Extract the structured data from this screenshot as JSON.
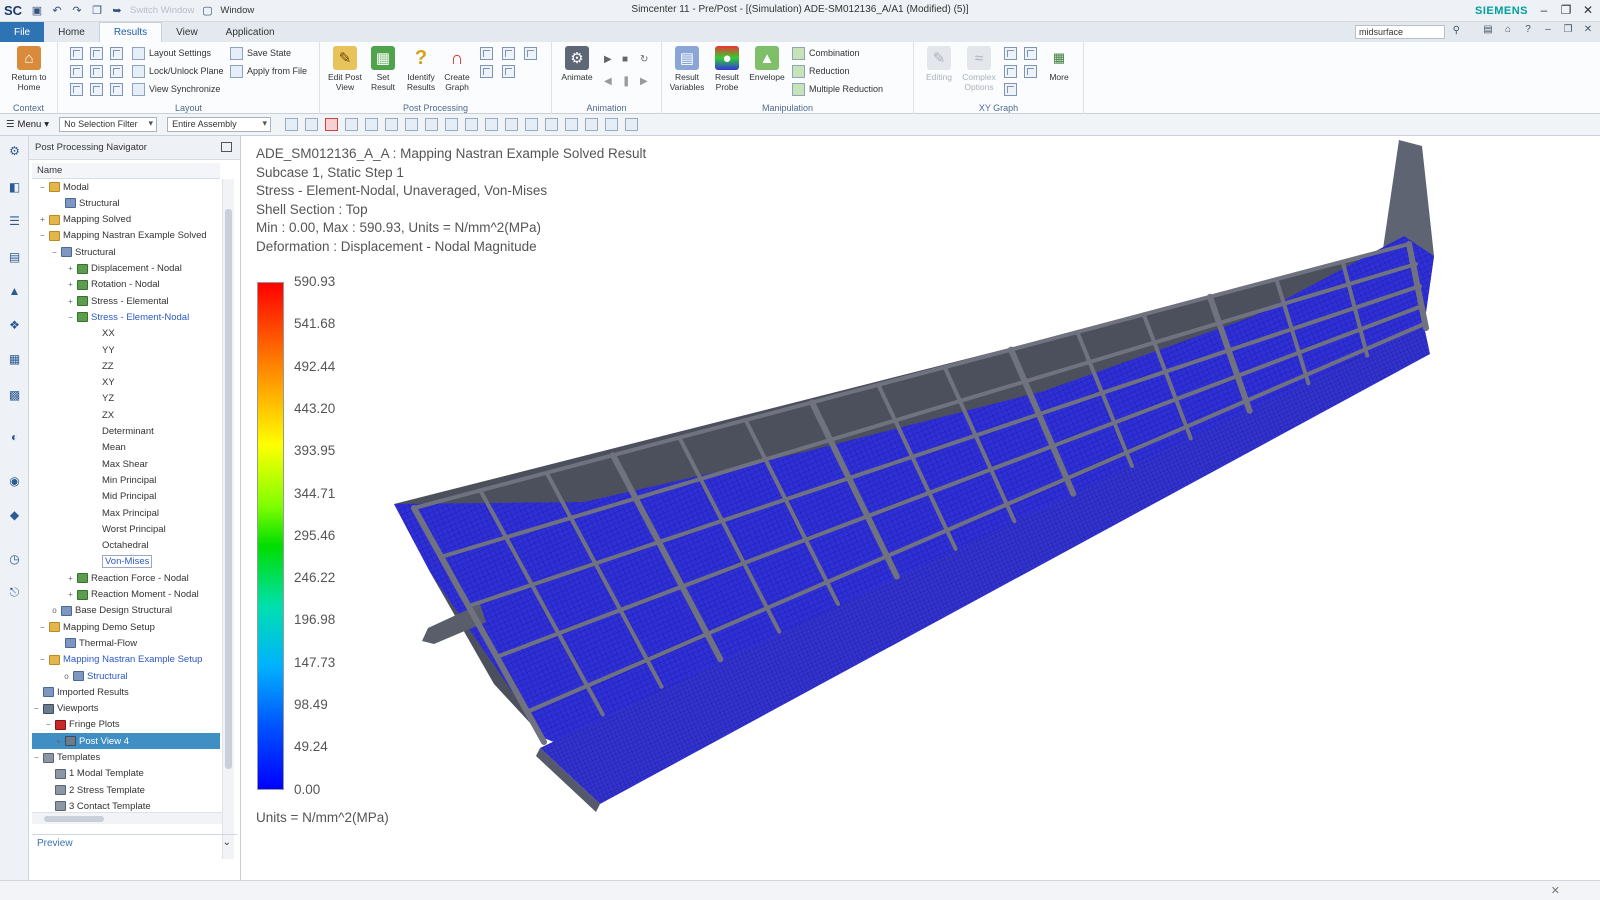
{
  "titlebar": {
    "logo": "SC",
    "switch_window": "Switch Window",
    "window_menu": "Window",
    "title": "Simcenter 11 - Pre/Post - [(Simulation) ADE-SM012136_A/A1 (Modified)   (5)]",
    "brand": "SIEMENS"
  },
  "tabs": [
    {
      "label": "File",
      "kind": "file"
    },
    {
      "label": "Home",
      "kind": "normal"
    },
    {
      "label": "Results",
      "kind": "active"
    },
    {
      "label": "View",
      "kind": "normal"
    },
    {
      "label": "Application",
      "kind": "normal"
    }
  ],
  "search": {
    "value": "midsurface"
  },
  "ribbon": {
    "context": {
      "label": "Context",
      "return_home": "Return to Home"
    },
    "layout": {
      "label": "Layout",
      "layout_settings": "Layout Settings",
      "lock_unlock": "Lock/Unlock Plane",
      "view_sync": "View Synchronize",
      "save_state": "Save State",
      "apply_from_file": "Apply from File"
    },
    "post_processing": {
      "label": "Post Processing",
      "edit_post_view": "Edit Post View",
      "set_result": "Set Result",
      "identify_results": "Identify Results",
      "create_graph": "Create Graph"
    },
    "animation": {
      "label": "Animation",
      "animate": "Animate"
    },
    "manipulation": {
      "label": "Manipulation",
      "result_variables": "Result Variables",
      "result_probe": "Result Probe",
      "envelope": "Envelope",
      "combination": "Combination",
      "reduction": "Reduction",
      "multiple_reduction": "Multiple Reduction"
    },
    "xy_graph": {
      "label": "XY Graph",
      "editing": "Editing",
      "complex_options": "Complex Options",
      "more": "More"
    }
  },
  "toolbar": {
    "menu": "Menu",
    "selection_filter": "No Selection Filter",
    "scope": "Entire Assembly"
  },
  "navigator": {
    "title": "Post Processing Navigator",
    "column": "Name",
    "rows": [
      {
        "label": "Modal",
        "icon": "folder",
        "exp": "−"
      },
      {
        "label": "Structural",
        "icon": "struct",
        "exp": ""
      },
      {
        "label": "Mapping Solved",
        "icon": "folder",
        "exp": "+"
      },
      {
        "label": "Mapping Nastran Example Solved",
        "icon": "folder",
        "exp": "−"
      },
      {
        "label": "Structural",
        "icon": "struct",
        "exp": "−"
      },
      {
        "label": "Displacement - Nodal",
        "icon": "res",
        "exp": "+"
      },
      {
        "label": "Rotation - Nodal",
        "icon": "res",
        "exp": "+"
      },
      {
        "label": "Stress - Elemental",
        "icon": "res",
        "exp": "+"
      },
      {
        "label": "Stress - Element-Nodal",
        "icon": "res",
        "exp": "−",
        "style": "link"
      },
      {
        "label": "XX",
        "icon": "none",
        "exp": ""
      },
      {
        "label": "YY",
        "icon": "none",
        "exp": ""
      },
      {
        "label": "ZZ",
        "icon": "none",
        "exp": ""
      },
      {
        "label": "XY",
        "icon": "none",
        "exp": ""
      },
      {
        "label": "YZ",
        "icon": "none",
        "exp": ""
      },
      {
        "label": "ZX",
        "icon": "none",
        "exp": ""
      },
      {
        "label": "Determinant",
        "icon": "none",
        "exp": ""
      },
      {
        "label": "Mean",
        "icon": "none",
        "exp": ""
      },
      {
        "label": "Max Shear",
        "icon": "none",
        "exp": ""
      },
      {
        "label": "Min Principal",
        "icon": "none",
        "exp": ""
      },
      {
        "label": "Mid Principal",
        "icon": "none",
        "exp": ""
      },
      {
        "label": "Max Principal",
        "icon": "none",
        "exp": ""
      },
      {
        "label": "Worst Principal",
        "icon": "none",
        "exp": ""
      },
      {
        "label": "Octahedral",
        "icon": "none",
        "exp": ""
      },
      {
        "label": "Von-Mises",
        "icon": "none",
        "exp": "",
        "style": "boxed"
      },
      {
        "label": "Reaction Force - Nodal",
        "icon": "res",
        "exp": "+"
      },
      {
        "label": "Reaction Moment - Nodal",
        "icon": "res",
        "exp": "+"
      },
      {
        "label": "Base Design Structural",
        "icon": "struct",
        "exp": "o"
      },
      {
        "label": "Mapping Demo Setup",
        "icon": "folder",
        "exp": "−"
      },
      {
        "label": "Thermal-Flow",
        "icon": "struct",
        "exp": ""
      },
      {
        "label": "Mapping Nastran Example Setup",
        "icon": "folder",
        "exp": "−",
        "style": "link"
      },
      {
        "label": "Structural",
        "icon": "struct",
        "exp": "o",
        "style": "link"
      },
      {
        "label": "Imported Results",
        "icon": "struct",
        "exp": ""
      },
      {
        "label": "Viewports",
        "icon": "view",
        "exp": "−"
      },
      {
        "label": "Fringe Plots",
        "icon": "red",
        "exp": "−"
      },
      {
        "label": "Post View 4",
        "icon": "view",
        "exp": "+",
        "style": "sel"
      },
      {
        "label": "Templates",
        "icon": "tmpl",
        "exp": "−"
      },
      {
        "label": "1 Modal Template",
        "icon": "tmpl",
        "exp": ""
      },
      {
        "label": "2 Stress Template",
        "icon": "tmpl",
        "exp": ""
      },
      {
        "label": "3 Contact Template",
        "icon": "tmpl",
        "exp": ""
      }
    ],
    "preview": "Preview"
  },
  "viewport": {
    "info": [
      "ADE_SM012136_A_A : Mapping Nastran Example Solved Result",
      "Subcase 1, Static Step 1",
      "Stress - Element-Nodal, Unaveraged, Von-Mises",
      "Shell Section : Top",
      "Min : 0.00, Max : 590.93, Units = N/mm^2(MPa)",
      "Deformation : Displacement - Nodal Magnitude"
    ],
    "legend_ticks": [
      "590.93",
      "541.68",
      "492.44",
      "443.20",
      "393.95",
      "344.71",
      "295.46",
      "246.22",
      "196.98",
      "147.73",
      "98.49",
      "49.24",
      "0.00"
    ],
    "units": "Units = N/mm^2(MPa)",
    "colors": {
      "mesh": "#2f2fd8",
      "ribs": "#6a6a78",
      "background": "#ffffff"
    }
  }
}
